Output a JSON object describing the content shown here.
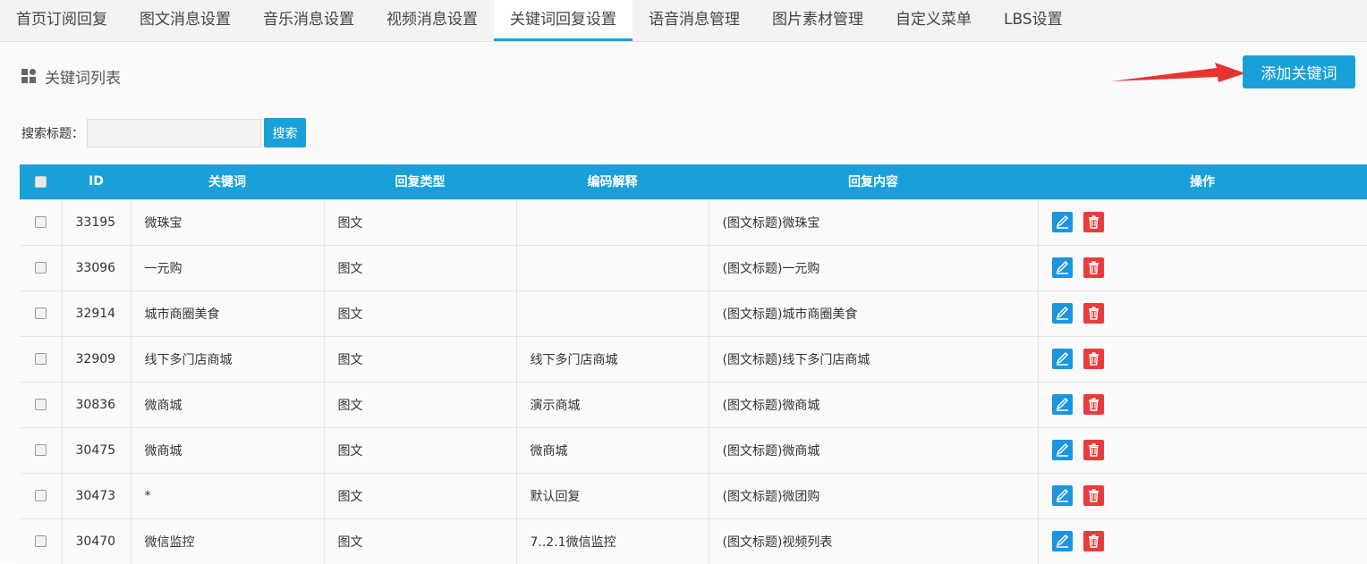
{
  "tabs": [
    {
      "label": "首页订阅回复"
    },
    {
      "label": "图文消息设置"
    },
    {
      "label": "音乐消息设置"
    },
    {
      "label": "视频消息设置"
    },
    {
      "label": "关键词回复设置"
    },
    {
      "label": "语音消息管理"
    },
    {
      "label": "图片素材管理"
    },
    {
      "label": "自定义菜单"
    },
    {
      "label": "LBS设置"
    }
  ],
  "active_tab": "关键词回复设置",
  "section": {
    "title": "关键词列表",
    "icon": "grid-icon"
  },
  "add_button": {
    "label": "添加关键词"
  },
  "search": {
    "label": "搜索标题：",
    "value": "",
    "button": "搜索"
  },
  "table": {
    "headers": {
      "id": "ID",
      "keyword": "关键词",
      "type": "回复类型",
      "code": "编码解释",
      "content": "回复内容",
      "ops": "操作"
    },
    "rows": [
      {
        "id": "33195",
        "keyword": "微珠宝",
        "type": "图文",
        "code": "",
        "content": "(图文标题)微珠宝"
      },
      {
        "id": "33096",
        "keyword": "一元购",
        "type": "图文",
        "code": "",
        "content": "(图文标题)一元购"
      },
      {
        "id": "32914",
        "keyword": "城市商圈美食",
        "type": "图文",
        "code": "",
        "content": "(图文标题)城市商圈美食"
      },
      {
        "id": "32909",
        "keyword": "线下多门店商城",
        "type": "图文",
        "code": "线下多门店商城",
        "content": "(图文标题)线下多门店商城"
      },
      {
        "id": "30836",
        "keyword": "微商城",
        "type": "图文",
        "code": "演示商城",
        "content": "(图文标题)微商城"
      },
      {
        "id": "30475",
        "keyword": "微商城",
        "type": "图文",
        "code": "微商城",
        "content": "(图文标题)微商城"
      },
      {
        "id": "30473",
        "keyword": "*",
        "type": "图文",
        "code": "默认回复",
        "content": "(图文标题)微团购"
      },
      {
        "id": "30470",
        "keyword": "微信监控",
        "type": "图文",
        "code": "7..2.1微信监控",
        "content": "(图文标题)视频列表"
      }
    ]
  },
  "colors": {
    "accent": "#1aa0d8",
    "edit": "#1b95dd",
    "delete": "#e83c3c",
    "arrow": "#e8332f"
  }
}
